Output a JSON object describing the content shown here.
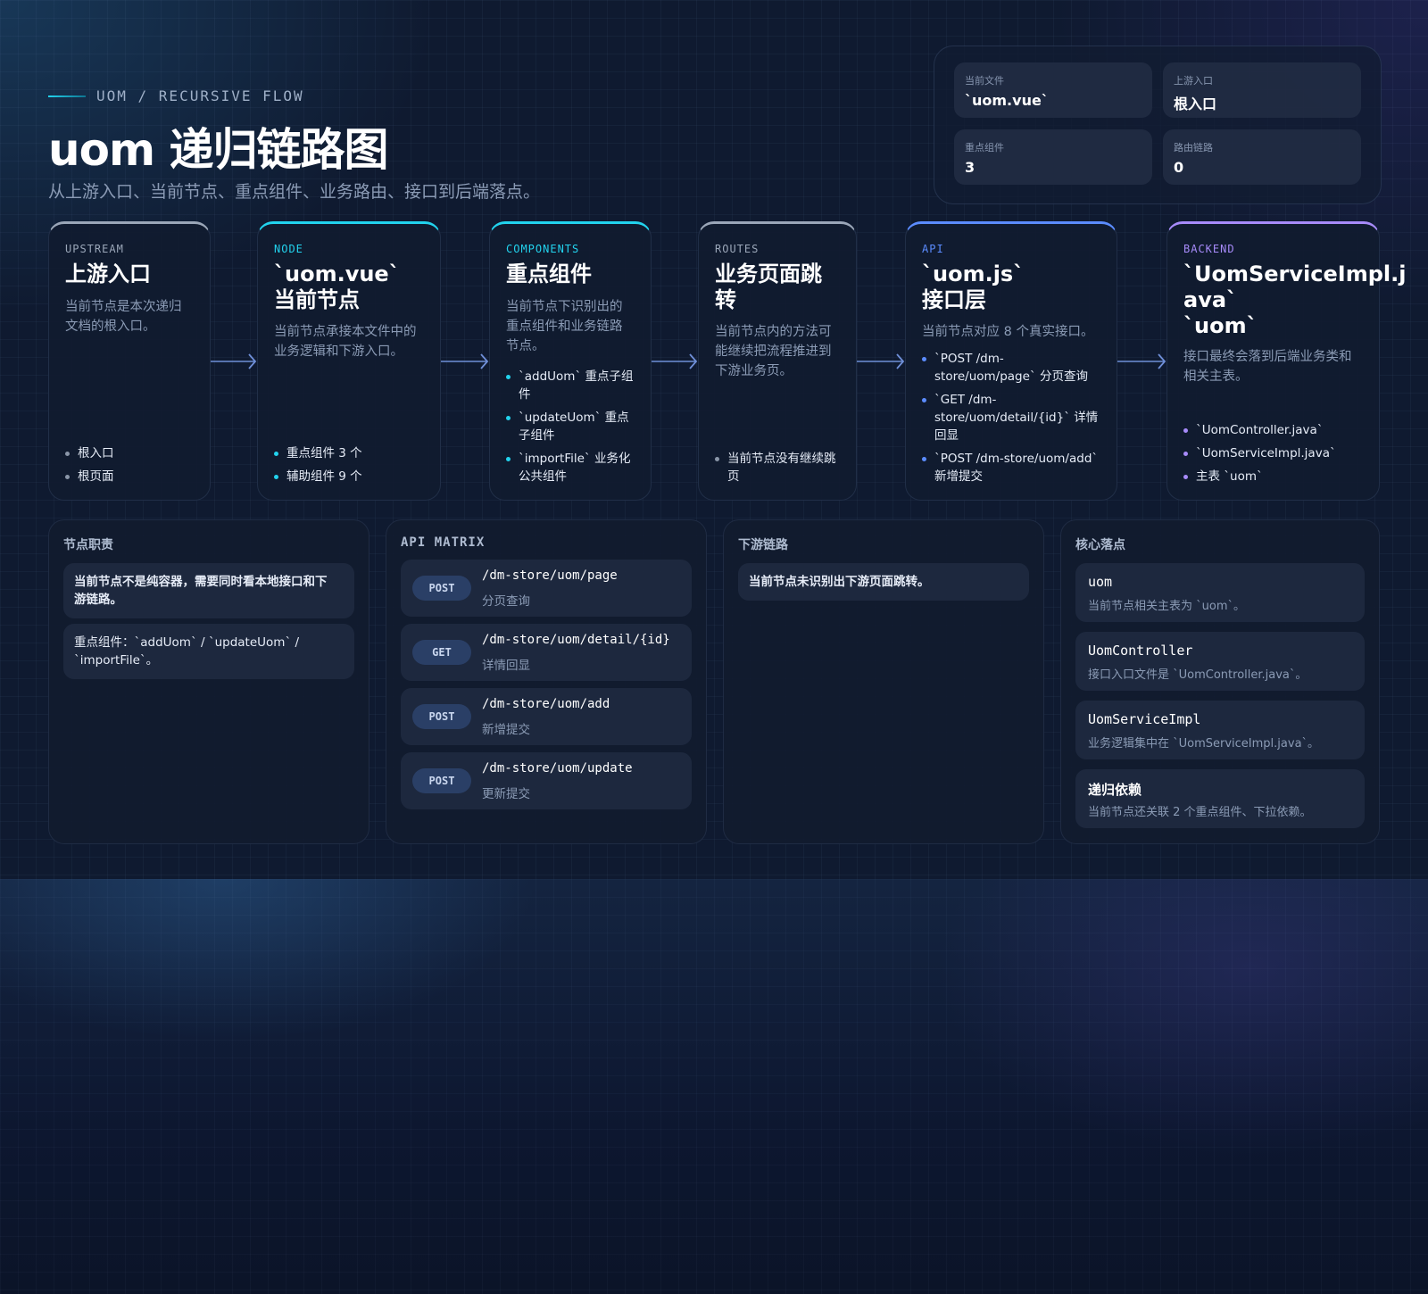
{
  "header": {
    "eyebrow": "UOM / RECURSIVE FLOW",
    "title": "uom 递归链路图",
    "subtitle": "从上游入口、当前节点、重点组件、业务路由、接口到后端落点。"
  },
  "stats": [
    {
      "label": "当前文件",
      "value": "`uom.vue`"
    },
    {
      "label": "上游入口",
      "value": "根入口"
    },
    {
      "label": "重点组件",
      "value": "3"
    },
    {
      "label": "路由链路",
      "value": "0"
    }
  ],
  "flow": [
    {
      "tag": "UPSTREAM",
      "color": "#9aa6b8",
      "title_lines": [
        "上游入口"
      ],
      "desc": [
        "当前节点是本次递归",
        "文档的根入口。"
      ],
      "items": [
        [
          "根入口"
        ],
        [
          "根页面"
        ]
      ]
    },
    {
      "tag": "NODE",
      "color": "#22d3ee",
      "title_lines": [
        "`uom.vue`",
        "当前节点"
      ],
      "desc": [
        "当前节点承接本文件中的",
        "业务逻辑和下游入口。"
      ],
      "items": [
        [
          "重点组件 3 个"
        ],
        [
          "辅助组件 9 个"
        ]
      ]
    },
    {
      "tag": "COMPONENTS",
      "color": "#22d3ee",
      "title_lines": [
        "重点组件"
      ],
      "desc": [
        "当前节点下识别出的",
        "重点组件和业务链路",
        "节点。"
      ],
      "items": [
        [
          "`addUom` 重点子组",
          "件"
        ],
        [
          "`updateUom` 重点",
          "子组件"
        ],
        [
          "`importFile` 业务化",
          "公共组件"
        ]
      ]
    },
    {
      "tag": "ROUTES",
      "color": "#9aa6b8",
      "title_lines": [
        "业务页面跳",
        "转"
      ],
      "desc": [
        "当前节点内的方法可",
        "能继续把流程推进到",
        "下游业务页。"
      ],
      "items": [
        [
          "当前节点没有继续跳",
          "页"
        ]
      ]
    },
    {
      "tag": "API",
      "color": "#5b8cff",
      "title_lines": [
        "`uom.js`",
        "接口层"
      ],
      "desc": [
        "当前节点对应 8 个真实接口。"
      ],
      "items": [
        [
          "`POST /dm-",
          "store/uom/page` 分页查询"
        ],
        [
          "`GET /dm-",
          "store/uom/detail/{id}` 详情",
          "回显"
        ],
        [
          "`POST /dm-store/uom/add`",
          "新增提交"
        ]
      ]
    },
    {
      "tag": "BACKEND",
      "color": "#a78bfa",
      "title_lines": [
        "`UomServiceImpl.j",
        "ava`",
        "`uom`"
      ],
      "desc": [
        "接口最终会落到后端业务类和",
        "相关主表。"
      ],
      "items": [
        [
          "`UomController.java`"
        ],
        [
          "`UomServiceImpl.java`"
        ],
        [
          "主表 `uom`"
        ]
      ]
    }
  ],
  "panels": {
    "duty": {
      "title": "节点职责",
      "notes": [
        [
          "当前节点不是纯容器，需要同时看本地接口和下",
          "游链路。"
        ],
        [
          "重点组件：`addUom` / `updateUom` /",
          "`importFile`。"
        ]
      ]
    },
    "api": {
      "title": "API MATRIX",
      "rows": [
        {
          "method": "POST",
          "path": "/dm-store/uom/page",
          "desc": "分页查询"
        },
        {
          "method": "GET",
          "path": "/dm-store/uom/detail/{id}",
          "desc": "详情回显"
        },
        {
          "method": "POST",
          "path": "/dm-store/uom/add",
          "desc": "新增提交"
        },
        {
          "method": "POST",
          "path": "/dm-store/uom/update",
          "desc": "更新提交"
        }
      ]
    },
    "downstream": {
      "title": "下游链路",
      "notes": [
        [
          "当前节点未识别出下游页面跳转。"
        ]
      ]
    },
    "core": {
      "title": "核心落点",
      "items": [
        {
          "title": "uom",
          "desc": "当前节点相关主表为 `uom`。"
        },
        {
          "title": "UomController",
          "desc": "接口入口文件是 `UomController.java`。"
        },
        {
          "title": "UomServiceImpl",
          "desc": "业务逻辑集中在 `UomServiceImpl.java`。"
        },
        {
          "title": "递归依赖",
          "desc": "当前节点还关联 2 个重点组件、下拉依赖。"
        }
      ]
    }
  }
}
